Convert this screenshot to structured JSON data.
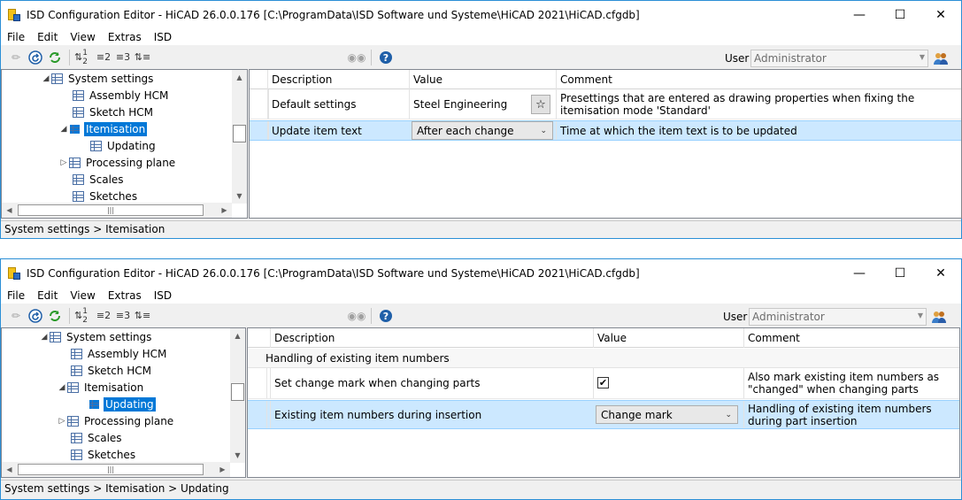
{
  "windows": [
    {
      "title": "ISD Configuration Editor  -  HiCAD 26.0.0.176 [C:\\ProgramData\\ISD Software und Systeme\\HiCAD 2021\\HiCAD.cfgdb]",
      "menu": [
        "File",
        "Edit",
        "View",
        "Extras",
        "ISD"
      ],
      "toolbar": {
        "btn_1_2": "1 2",
        "btn_2": "2",
        "btn_3": "3"
      },
      "user_label": "User",
      "user_value": "Administrator",
      "tree": [
        {
          "label": "System settings",
          "expander": "◢",
          "selected": false
        },
        {
          "label": "Assembly HCM",
          "expander": "",
          "selected": false
        },
        {
          "label": "Sketch HCM",
          "expander": "",
          "selected": false
        },
        {
          "label": "Itemisation",
          "expander": "◢",
          "selected": true
        },
        {
          "label": "Updating",
          "expander": "",
          "selected": false
        },
        {
          "label": "Processing plane",
          "expander": "▷",
          "selected": false
        },
        {
          "label": "Scales",
          "expander": "",
          "selected": false
        },
        {
          "label": "Sketches",
          "expander": "",
          "selected": false
        }
      ],
      "grid": {
        "headers": [
          "Description",
          "Value",
          "Comment"
        ],
        "rows": [
          {
            "description": "Default settings",
            "value": "Steel Engineering",
            "comment": "Presettings that are entered as drawing properties when fixing the itemisation mode 'Standard'"
          },
          {
            "description": "Update item text",
            "value": "After each change",
            "comment": "Time at which the item text is to be updated"
          }
        ]
      },
      "status": "System settings > Itemisation"
    },
    {
      "title": "ISD Configuration Editor  -  HiCAD 26.0.0.176 [C:\\ProgramData\\ISD Software und Systeme\\HiCAD 2021\\HiCAD.cfgdb]",
      "menu": [
        "File",
        "Edit",
        "View",
        "Extras",
        "ISD"
      ],
      "toolbar": {
        "btn_1_2": "1 2",
        "btn_2": "2",
        "btn_3": "3"
      },
      "user_label": "User",
      "user_value": "Administrator",
      "tree": [
        {
          "label": "System settings",
          "expander": "◢",
          "selected": false
        },
        {
          "label": "Assembly HCM",
          "expander": "",
          "selected": false
        },
        {
          "label": "Sketch HCM",
          "expander": "",
          "selected": false
        },
        {
          "label": "Itemisation",
          "expander": "◢",
          "selected": false
        },
        {
          "label": "Updating",
          "expander": "",
          "selected": true
        },
        {
          "label": "Processing plane",
          "expander": "▷",
          "selected": false
        },
        {
          "label": "Scales",
          "expander": "",
          "selected": false
        },
        {
          "label": "Sketches",
          "expander": "",
          "selected": false
        }
      ],
      "grid": {
        "headers": [
          "Description",
          "Value",
          "Comment"
        ],
        "group": "Handling of existing item numbers",
        "rows": [
          {
            "description": "Set change mark when changing parts",
            "value_checked": true,
            "comment": "Also mark existing item numbers as \"changed\" when changing parts"
          },
          {
            "description": "Existing item numbers during insertion",
            "value": "Change mark",
            "comment": "Handling of existing item numbers during part insertion"
          }
        ]
      },
      "status": "System settings > Itemisation > Updating"
    }
  ],
  "colors": {
    "accent": "#0078d7",
    "selected_row": "#cce8ff",
    "window_border": "#2b8fd6"
  },
  "icons": [
    "app-icon",
    "pencil-icon",
    "undo-icon",
    "refresh-icon",
    "sort-icon",
    "binoculars-icon",
    "help-icon",
    "users-icon",
    "star-icon",
    "checkmark-icon"
  ]
}
